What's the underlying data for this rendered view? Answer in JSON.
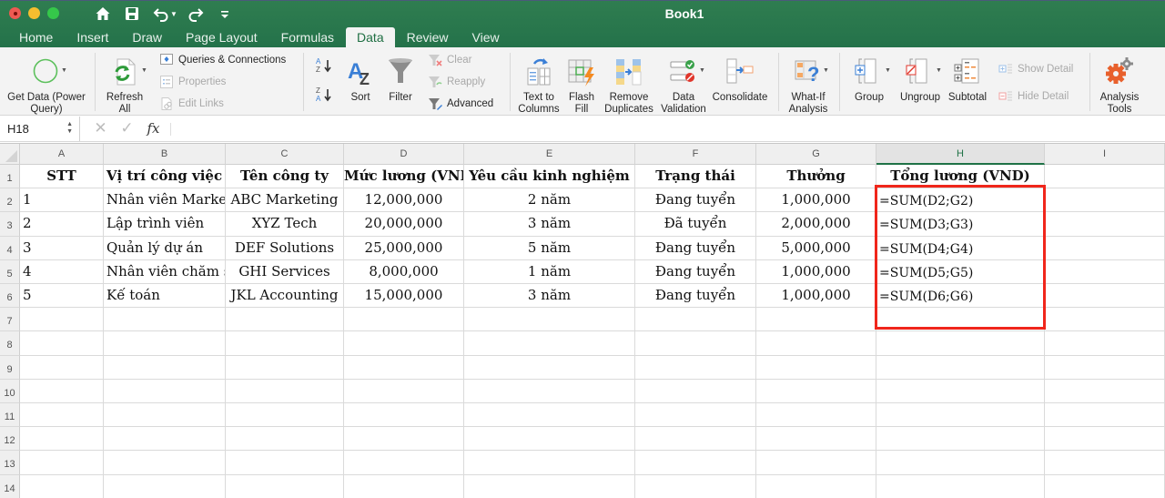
{
  "window": {
    "title": "Book1",
    "traffic_lights": [
      "close",
      "minimize",
      "maximize"
    ]
  },
  "quick_access": [
    {
      "name": "home-icon"
    },
    {
      "name": "save-icon"
    },
    {
      "name": "undo-icon"
    },
    {
      "name": "redo-icon"
    },
    {
      "name": "customize-qat-icon"
    }
  ],
  "tabs": [
    {
      "label": "Home",
      "active": false
    },
    {
      "label": "Insert",
      "active": false
    },
    {
      "label": "Draw",
      "active": false
    },
    {
      "label": "Page Layout",
      "active": false
    },
    {
      "label": "Formulas",
      "active": false
    },
    {
      "label": "Data",
      "active": true
    },
    {
      "label": "Review",
      "active": false
    },
    {
      "label": "View",
      "active": false
    }
  ],
  "ribbon": {
    "get_data": {
      "line1": "Get Data (Power",
      "line2": "Query)"
    },
    "refresh_all": {
      "line1": "Refresh",
      "line2": "All"
    },
    "queries_connections": "Queries & Connections",
    "properties": "Properties",
    "edit_links": "Edit Links",
    "sort_az": "A→Z",
    "sort_za": "Z→A",
    "sort": "Sort",
    "filter": "Filter",
    "clear": "Clear",
    "reapply": "Reapply",
    "advanced": "Advanced",
    "text_to_columns": {
      "line1": "Text to",
      "line2": "Columns"
    },
    "flash_fill": {
      "line1": "Flash",
      "line2": "Fill"
    },
    "remove_duplicates": {
      "line1": "Remove",
      "line2": "Duplicates"
    },
    "data_validation": {
      "line1": "Data",
      "line2": "Validation"
    },
    "consolidate": "Consolidate",
    "what_if": {
      "line1": "What-If",
      "line2": "Analysis"
    },
    "group": "Group",
    "ungroup": "Ungroup",
    "subtotal": "Subtotal",
    "show_detail": "Show Detail",
    "hide_detail": "Hide Detail",
    "analysis_tools": {
      "line1": "Analysis",
      "line2": "Tools"
    }
  },
  "formula_bar": {
    "name_box": "H18",
    "cancel": "✕",
    "enter": "✓",
    "fx": "fx",
    "value": ""
  },
  "sheet": {
    "columns": [
      "A",
      "B",
      "C",
      "D",
      "E",
      "F",
      "G",
      "H",
      "I"
    ],
    "active_column": "H",
    "rows": [
      "1",
      "2",
      "3",
      "4",
      "5",
      "6",
      "7",
      "8",
      "9",
      "10",
      "11",
      "12",
      "13",
      "14"
    ],
    "header": [
      "STT",
      "Vị trí công việc",
      "Tên công ty",
      "Mức lương (VND)",
      "Yêu cầu kinh nghiệm",
      "Trạng thái",
      "Thưởng",
      "Tổng lương (VND)",
      ""
    ],
    "data": [
      [
        "1",
        "Nhân viên Marketing",
        "ABC Marketing",
        "12,000,000",
        "2 năm",
        "Đang tuyển",
        "1,000,000",
        "=SUM(D2;G2)"
      ],
      [
        "2",
        "Lập trình viên",
        "XYZ Tech",
        "20,000,000",
        "3 năm",
        "Đã tuyển",
        "2,000,000",
        "=SUM(D3;G3)"
      ],
      [
        "3",
        "Quản lý dự án",
        "DEF Solutions",
        "25,000,000",
        "5 năm",
        "Đang tuyển",
        "5,000,000",
        "=SUM(D4;G4)"
      ],
      [
        "4",
        "Nhân viên chăm sóc khách hàng",
        "GHI Services",
        "8,000,000",
        "1 năm",
        "Đang tuyển",
        "1,000,000",
        "=SUM(D5;G5)"
      ],
      [
        "5",
        "Kế toán",
        "JKL Accounting",
        "15,000,000",
        "3 năm",
        "Đang tuyển",
        "1,000,000",
        "=SUM(D6;G6)"
      ]
    ],
    "highlight_color": "#f0261b"
  }
}
